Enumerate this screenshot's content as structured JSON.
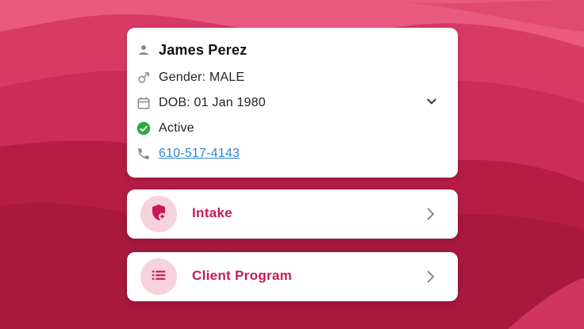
{
  "colors": {
    "accent": "#c8195a",
    "link": "#2a86d1",
    "active": "#2ea84a",
    "background": "#c0234f"
  },
  "profile": {
    "name": "James Perez",
    "gender": "Gender: MALE",
    "dob": "DOB: 01 Jan 1980",
    "status": "Active",
    "phone": "610-517-4143"
  },
  "actions": [
    {
      "label": "Intake",
      "icon": "shield-plus-icon"
    },
    {
      "label": "Client Program",
      "icon": "list-icon"
    }
  ]
}
